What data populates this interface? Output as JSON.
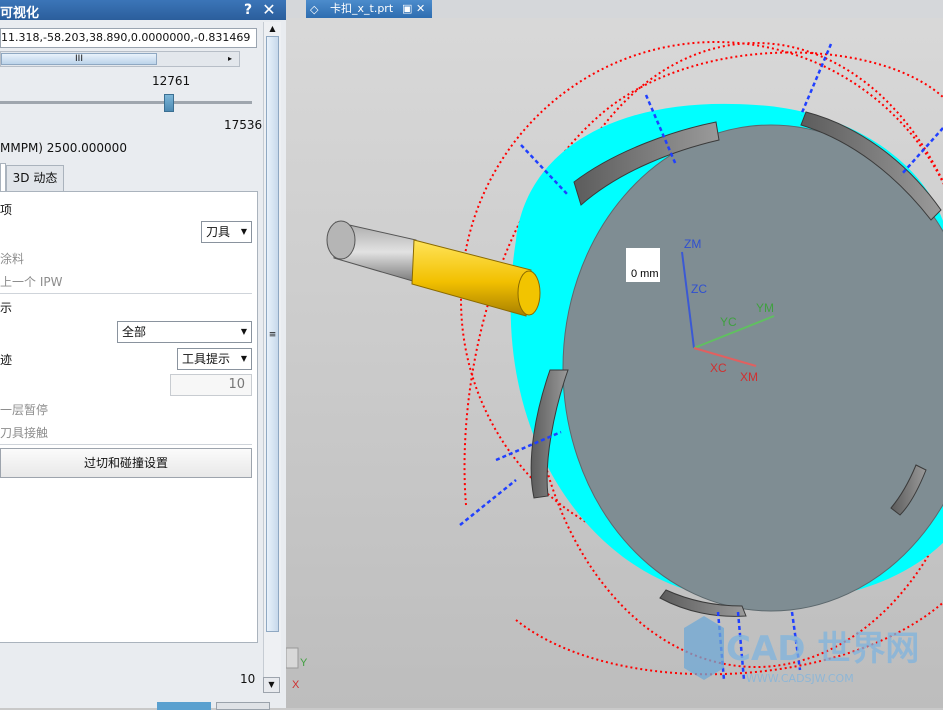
{
  "dialog": {
    "title": "可视化",
    "help_label": "?",
    "close_label": "✕",
    "coordinates": "11.318,-58.203,38.890,0.0000000,-0.831469",
    "scroll_grip": "III",
    "scroll_right": "▸",
    "slider": {
      "value": "12761",
      "max": "17536",
      "fraction": 0.728
    },
    "speed_text": "MMPM) 2500.000000",
    "tabs": [
      {
        "label": ""
      },
      {
        "label": "3D 动态"
      }
    ],
    "panel": {
      "section1_label": "项",
      "tool_dropdown": "刀具",
      "remove_material": "涂料",
      "prev_ipw": "上一个 IPW",
      "section2_label": "示",
      "display_dropdown": "全部",
      "section3_label": "迹",
      "tooltip_dropdown": "工具提示",
      "number_value": "10",
      "layer_pause": "一层暂停",
      "tool_contact": "刀具接触",
      "collision_button": "过切和碰撞设置"
    },
    "bottom_number": "10"
  },
  "viewport": {
    "file_tab": "卡扣_x_t.prt",
    "dimension_label": "0 mm",
    "csys": {
      "zm": "ZM",
      "zc": "ZC",
      "yc": "YC",
      "ym": "YM",
      "xc": "XC",
      "xm": "XM"
    },
    "triad": {
      "y": "Y",
      "x": "X"
    },
    "watermark": {
      "main": "CAD 世界网",
      "sub": "WWW.CADSJW.COM"
    },
    "colors": {
      "background": "#c9c9c9",
      "disc": "#7f8d93",
      "blank": "#00ffff",
      "tool_holder": "#f5c400",
      "toolpath": "#ff0000",
      "axis": "#2040ff"
    }
  }
}
